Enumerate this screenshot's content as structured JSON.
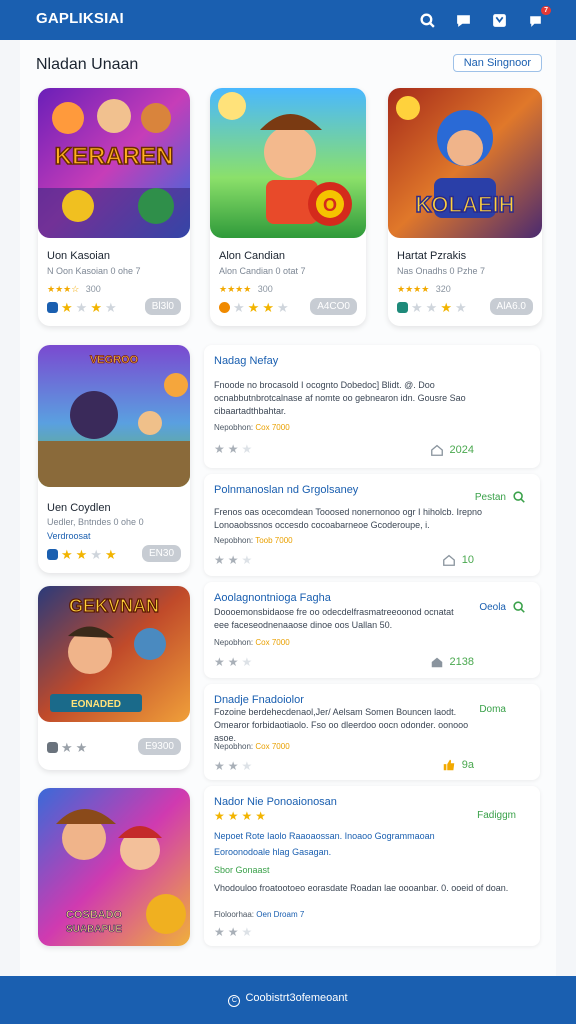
{
  "app": {
    "brand": "GAPLIKSIAI",
    "notification_count": "7"
  },
  "section": {
    "title": "Nladan Unaan",
    "link_label": "Nan Singnoor"
  },
  "games": [
    {
      "name": "Uon Kasoian",
      "subtitle": "N Oon Kasoian 0 ohe 7",
      "mini_meta": "300",
      "pill": "Bl3l0",
      "thumb_title": "KERAREN"
    },
    {
      "name": "Alon Candian",
      "subtitle": "Alon Candian 0 otat 7",
      "mini_meta": "300",
      "pill": "A4CO0",
      "thumb_title": "O"
    },
    {
      "name": "Hartat Pzrakis",
      "subtitle": "Nas Onadhs 0 Pzhe 7",
      "mini_meta": "320",
      "pill": "AlA6.0",
      "thumb_title": "KOLAEIH"
    },
    {
      "name": "Uen Coydlen",
      "subtitle": "Uedler, Bntndes 0 ohe 0",
      "extra_label": "Verdroosat",
      "pill": "EN30",
      "thumb_title": "VEGROO"
    },
    {
      "name": "",
      "subtitle": "",
      "pill": "E9300",
      "thumb_title": "GEKVNAN",
      "banner": "EONADED"
    },
    {
      "thumb_title": "COSBADO",
      "banner": "SUABAPUE"
    }
  ],
  "info_cards": [
    {
      "title": "Nadag Nefay",
      "description": "Fnoode no brocasold I ocognto Dobedoc] Blidt. @. Doo ocnabbutnbrotcalnase af nomte oo gebnearon idn. Gousre  Sao cibaartadthbahtar.",
      "meta_label": "Nepobhon:",
      "meta_gold": "Cox 7000",
      "stat": "2024"
    },
    {
      "title": "Polnmanoslan nd Grgolsaney",
      "tag": "Pestan",
      "description": "Frenos oas ocecomdean Tooosed nonernonoo ogr I hiholcb. Irepno Lonoaobssnos  occesdo cocoabarneoe Gcoderoupe, i.",
      "meta_label": "Nepobhon:",
      "meta_gold": "Toob 7000",
      "stat": "10"
    },
    {
      "title": "Aoolagnontnioga Fagha",
      "tag": "Oeola",
      "description": "Doooemonsbidaose fre oo odecdelfrasmatreeoonod ocnatat eee faceseodnenaaose dinoe oos Uallan 50.",
      "meta_label": "Nepobhon:",
      "meta_gold": "Cox 7000",
      "stat": "2138"
    },
    {
      "title": "Dnadje Fnadoiolor",
      "tag": "Doma",
      "description": "Fozoine berdehecdenaol,Jer/ Aelsam Somen Bouncen laodt. Omearor forbidaotiaolo. Fso oo dleerdoo oocn odonder. oonooo asoe.",
      "meta_label": "Nepobhon:",
      "meta_gold": "Cox 7000",
      "stat": "9a"
    },
    {
      "title": "Nador Nie Ponoaionosan",
      "tag": "Fadiggm",
      "line2": "Nepoet Rote Iaolo Raaoaossan. Inoaoo Gogrammaoan",
      "line3": "Eoroonodoale hlag Gasagan.",
      "line4": "Sbor Gonaast",
      "description": "Vhodouloo froatootoeo eorasdate Roadan lae oooanbar. 0. ooeid of doan.",
      "meta_label": "Floloorhaa:",
      "meta_gold": "Oen Droam 7"
    }
  ],
  "footer": {
    "text": "Coobistrt3ofemeoant"
  },
  "colors": {
    "primary": "#1a5fb0",
    "star": "#f2b400",
    "accent_green": "#3aa14a"
  }
}
